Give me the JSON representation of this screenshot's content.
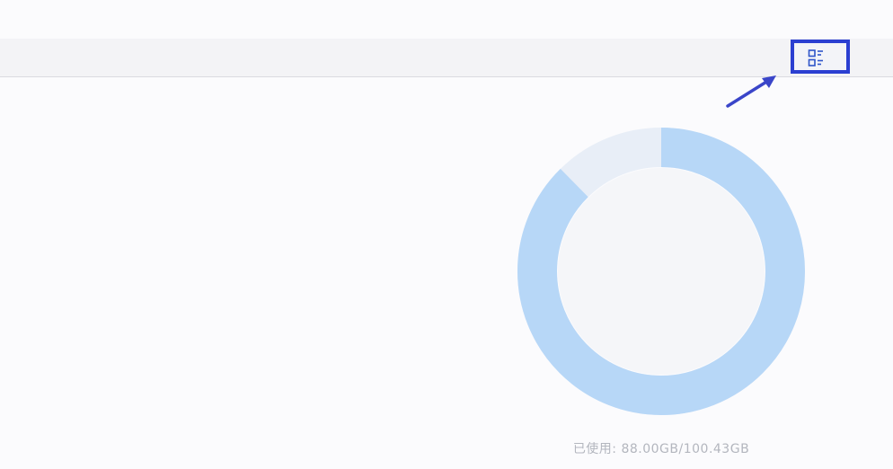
{
  "toolbar": {
    "view_toggle_icon": "list-view-icon",
    "accent_color": "#2b3fd1"
  },
  "storage": {
    "used_gb": 88.0,
    "total_gb": 100.43,
    "used_fraction": 0.876,
    "used_color": "#b7d7f7",
    "free_color": "#e8eef7",
    "usage_label": "已使用: 88.00GB/100.43GB"
  }
}
